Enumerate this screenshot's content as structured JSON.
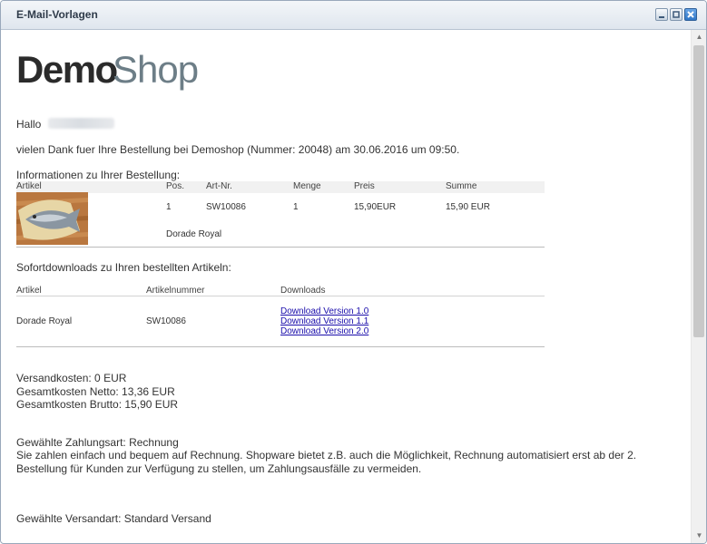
{
  "window": {
    "title": "E-Mail-Vorlagen"
  },
  "logo": {
    "demo": "Demo",
    "shop": "Shop"
  },
  "greeting": "Hallo",
  "intro": "vielen Dank fuer Ihre Bestellung bei Demoshop (Nummer: 20048) am 30.06.2016 um 09:50.",
  "order": {
    "heading": "Informationen zu Ihrer Bestellung:",
    "columns": [
      "Artikel",
      "Pos.",
      "Art-Nr.",
      "Menge",
      "Preis",
      "Summe"
    ],
    "row": {
      "pos": "1",
      "artnr": "SW10086",
      "menge": "1",
      "preis": "15,90EUR",
      "summe": "15,90 EUR",
      "name": "Dorade Royal"
    }
  },
  "downloads": {
    "heading": "Sofortdownloads zu Ihren bestellten Artikeln:",
    "columns": [
      "Artikel",
      "Artikelnummer",
      "Downloads"
    ],
    "row": {
      "article": "Dorade Royal",
      "number": "SW10086",
      "links": [
        "Download Version 1.0",
        "Download Version 1.1",
        "Download Version 2.0"
      ]
    }
  },
  "costs": {
    "shipping": "Versandkosten: 0 EUR",
    "net": "Gesamtkosten Netto: 13,36 EUR",
    "gross": "Gesamtkosten Brutto: 15,90 EUR"
  },
  "payment": {
    "method": "Gewählte Zahlungsart: Rechnung",
    "line1": "Sie zahlen einfach und bequem auf Rechnung. Shopware bietet z.B. auch die Möglichkeit, Rechnung automatisiert erst ab der 2.",
    "line2": "Bestellung für Kunden zur Verfügung zu stellen, um Zahlungsausfälle zu vermeiden."
  },
  "shipping_method": "Gewählte Versandart: Standard Versand",
  "icons": {
    "minimize": "minimize-icon",
    "maximize": "maximize-icon",
    "close": "close-icon"
  },
  "colors": {
    "link": "#1a0dab",
    "close_button": "#2f76c7"
  }
}
